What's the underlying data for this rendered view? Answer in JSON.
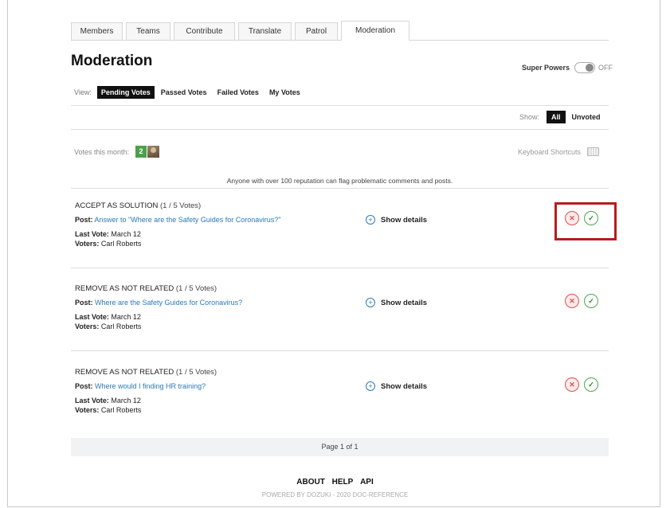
{
  "tabs": [
    "Members",
    "Teams",
    "Contribute",
    "Translate",
    "Patrol",
    "Moderation"
  ],
  "active_tab": "Moderation",
  "page_title": "Moderation",
  "super_powers": {
    "label": "Super Powers",
    "state": "OFF"
  },
  "view": {
    "label": "View:",
    "options": [
      "Pending Votes",
      "Passed Votes",
      "Failed Votes",
      "My Votes"
    ],
    "selected": "Pending Votes"
  },
  "show": {
    "label": "Show:",
    "options": [
      "All",
      "Unvoted"
    ],
    "selected": "All"
  },
  "votes_this_month": {
    "label": "Votes this month:",
    "count": "2"
  },
  "keyboard_shortcuts": "Keyboard Shortcuts",
  "notice": "Anyone with over 100 reputation can flag problematic comments and posts.",
  "votes": [
    {
      "type": "ACCEPT AS SOLUTION",
      "count": "(1 / 5 Votes)",
      "post_label": "Post:",
      "post_link": "Answer to \"Where are the Safety Guides for Coronavirus?\"",
      "last_vote_label": "Last Vote:",
      "last_vote": "March 12",
      "voters_label": "Voters:",
      "voters": "Carl Roberts",
      "details": "Show details"
    },
    {
      "type": "REMOVE AS NOT RELATED",
      "count": "(1 / 5 Votes)",
      "post_label": "Post:",
      "post_link": "Where are the Safety Guides for Coronavirus?",
      "last_vote_label": "Last Vote:",
      "last_vote": "March 12",
      "voters_label": "Voters:",
      "voters": "Carl Roberts",
      "details": "Show details"
    },
    {
      "type": "REMOVE AS NOT RELATED",
      "count": "(1 / 5 Votes)",
      "post_label": "Post:",
      "post_link": "Where would I finding HR training?",
      "last_vote_label": "Last Vote:",
      "last_vote": "March 12",
      "voters_label": "Voters:",
      "voters": "Carl Roberts",
      "details": "Show details"
    }
  ],
  "pager": "Page 1 of 1",
  "footer_links": [
    "ABOUT",
    "HELP",
    "API"
  ],
  "powered_by": "POWERED BY DOZUKI - 2020 DOC-REFERENCE",
  "icons": {
    "reject": "x-circle-icon",
    "approve": "check-circle-icon",
    "details": "plus-circle-icon",
    "keyboard": "keyboard-icon"
  },
  "colors": {
    "reject": "#d9534f",
    "approve": "#4aa84c",
    "link": "#2a7ab9",
    "badge": "#49a24b",
    "highlight": "#b51d1d"
  }
}
